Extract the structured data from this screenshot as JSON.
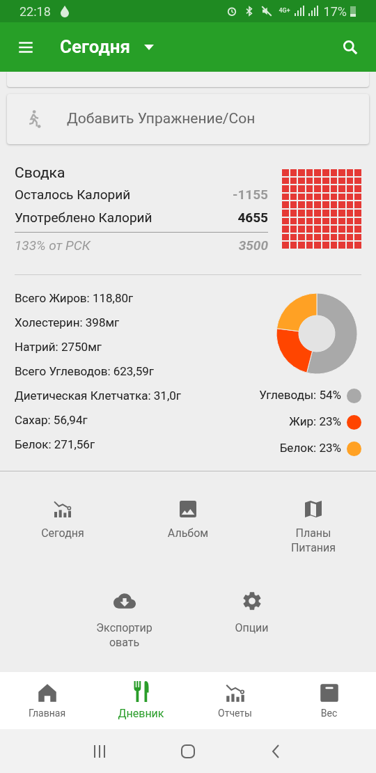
{
  "status_bar": {
    "time": "22:18",
    "network": "4G+",
    "battery": "17%"
  },
  "app_bar": {
    "title": "Сегодня"
  },
  "exercise_card": {
    "label": "Добавить Упражнение/Сон"
  },
  "summary": {
    "title": "Сводка",
    "rows": [
      {
        "label": "Осталось Калорий",
        "value": "-1155",
        "kind": "muted"
      },
      {
        "label": "Употреблено Калорий",
        "value": "4655",
        "kind": "bold"
      }
    ],
    "rdi": {
      "label": "133% от РСК",
      "value": "3500"
    }
  },
  "nutrients": [
    "Всего Жиров: 118,80г",
    "Холестерин: 398мг",
    "Натрий: 2750мг",
    "Всего Углеводов: 623,59г",
    "Диетическая Клетчатка: 31,0г",
    "Сахар: 56,94г",
    "Белок: 271,56г"
  ],
  "macros": {
    "chart_data": {
      "type": "donut",
      "values": [
        54,
        23,
        23
      ]
    },
    "legend": [
      {
        "label": "Углеводы: 54%",
        "color": "#a9a9a9"
      },
      {
        "label": "Жир: 23%",
        "color": "#ff4500"
      },
      {
        "label": "Белок: 23%",
        "color": "#ffa124"
      }
    ]
  },
  "menu": [
    {
      "label": "Сегодня",
      "kind": "chart"
    },
    {
      "label": "Альбом",
      "kind": "image"
    },
    {
      "label": "Планы Питания",
      "kind": "map"
    },
    {
      "label": "Экспортир овать",
      "kind": "cloud"
    },
    {
      "label": "Опции",
      "kind": "gear"
    }
  ],
  "bottom_nav": [
    {
      "label": "Главная",
      "kind": "home",
      "selected": false
    },
    {
      "label": "Дневник",
      "kind": "diary",
      "selected": true
    },
    {
      "label": "Отчеты",
      "kind": "chart",
      "selected": false
    },
    {
      "label": "Вес",
      "kind": "scale",
      "selected": false
    }
  ]
}
